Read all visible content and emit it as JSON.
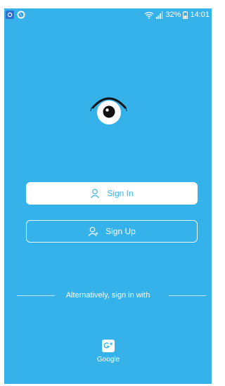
{
  "colors": {
    "background": "#35b2ea",
    "button_text": "#35b2ea",
    "white": "#ffffff"
  },
  "status_bar": {
    "notification_icons": [
      "app-notification-icon",
      "messaging-icon"
    ],
    "battery_percent": "32%",
    "time": "14:01"
  },
  "logo": {
    "icon": "eye-logo-icon"
  },
  "sign_in": {
    "label": "Sign In",
    "icon": "user-icon"
  },
  "sign_up": {
    "label": "Sign Up",
    "icon": "add-user-icon"
  },
  "alternative": {
    "text": "Alternatively, sign in with"
  },
  "google": {
    "label": "Google",
    "icon": "google-plus-icon"
  }
}
